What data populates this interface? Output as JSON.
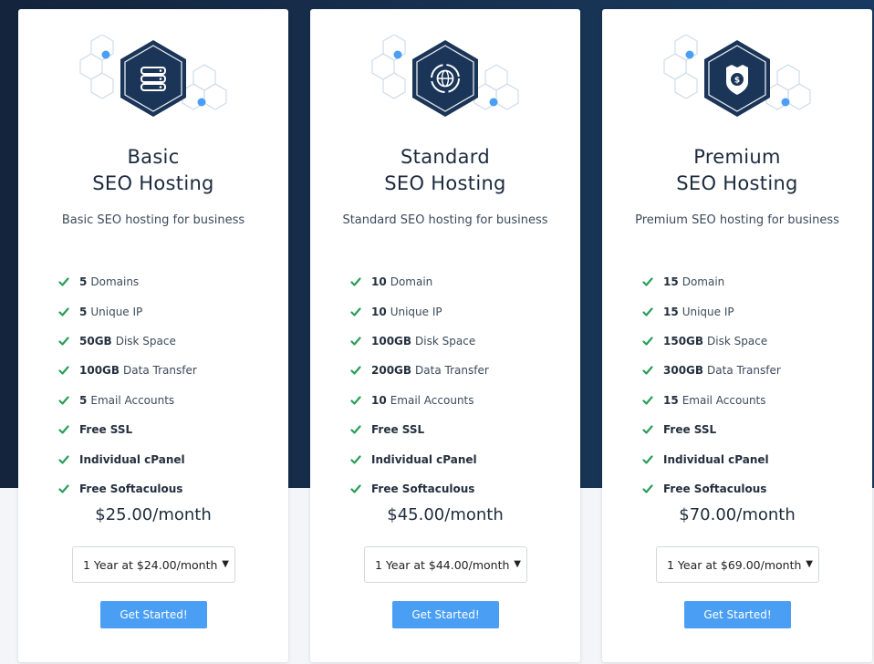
{
  "accent_color": "#4a9ff5",
  "check_color": "#2a9d57",
  "plans": [
    {
      "icon": "server-rack-icon",
      "title_line1": "Basic",
      "title_line2": "SEO Hosting",
      "subtitle": "Basic SEO hosting for business",
      "features": [
        {
          "bold": "5",
          "text": "Domains"
        },
        {
          "bold": "5",
          "text": "Unique IP"
        },
        {
          "bold": "50GB",
          "text": "Disk Space"
        },
        {
          "bold": "100GB",
          "text": "Data Transfer"
        },
        {
          "bold": "5",
          "text": "Email Accounts"
        },
        {
          "bold": "Free SSL",
          "text": ""
        },
        {
          "bold": "Individual cPanel",
          "text": ""
        },
        {
          "bold": "Free Softaculous",
          "text": ""
        }
      ],
      "price": "$25.00/month",
      "billing_selected": "1 Year at $24.00/month",
      "cta": "Get Started!"
    },
    {
      "icon": "globe-icon",
      "title_line1": "Standard",
      "title_line2": "SEO Hosting",
      "subtitle": "Standard SEO hosting for business",
      "features": [
        {
          "bold": "10",
          "text": "Domain"
        },
        {
          "bold": "10",
          "text": "Unique IP"
        },
        {
          "bold": "100GB",
          "text": "Disk Space"
        },
        {
          "bold": "200GB",
          "text": "Data Transfer"
        },
        {
          "bold": "10",
          "text": "Email Accounts"
        },
        {
          "bold": "Free SSL",
          "text": ""
        },
        {
          "bold": "Individual cPanel",
          "text": ""
        },
        {
          "bold": "Free Softaculous",
          "text": ""
        }
      ],
      "price": "$45.00/month",
      "billing_selected": "1 Year at $44.00/month",
      "cta": "Get Started!"
    },
    {
      "icon": "money-shield-icon",
      "title_line1": "Premium",
      "title_line2": "SEO Hosting",
      "subtitle": "Premium SEO hosting for business",
      "features": [
        {
          "bold": "15",
          "text": "Domain"
        },
        {
          "bold": "15",
          "text": "Unique IP"
        },
        {
          "bold": "150GB",
          "text": "Disk Space"
        },
        {
          "bold": "300GB",
          "text": "Data Transfer"
        },
        {
          "bold": "15",
          "text": "Email Accounts"
        },
        {
          "bold": "Free SSL",
          "text": ""
        },
        {
          "bold": "Individual cPanel",
          "text": ""
        },
        {
          "bold": "Free Softaculous",
          "text": ""
        }
      ],
      "price": "$70.00/month",
      "billing_selected": "1 Year at $69.00/month",
      "cta": "Get Started!"
    }
  ]
}
